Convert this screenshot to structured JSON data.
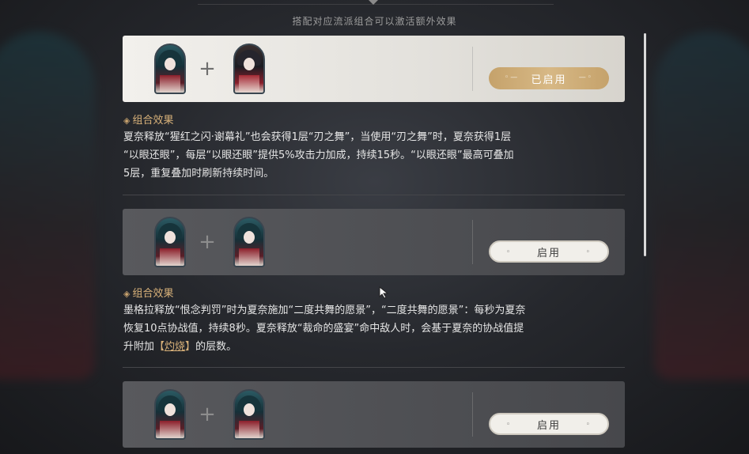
{
  "header": {
    "hint": "搭配对应流派组合可以激活额外效果"
  },
  "cards": [
    {
      "button_label": "已启用",
      "state": "enabled"
    },
    {
      "button_label": "启用",
      "state": "disabled"
    },
    {
      "button_label": "启用",
      "state": "disabled"
    }
  ],
  "effects": [
    {
      "title": "组合效果",
      "line1": "夏奈释放“猩红之闪·谢幕礼”也会获得1层“刃之舞”，当使用“刃之舞”时，夏奈获得1层",
      "line2": "“以眼还眼”，每层“以眼还眼”提供5%攻击力加成，持续15秒。“以眼还眼”最高可叠加",
      "line3": "5层，重复叠加时刷新持续时间。"
    },
    {
      "title": "组合效果",
      "line1": "墨格拉释放“恨念判罚”时为夏奈施加“二度共舞的愿景”，“二度共舞的愿景”：每秒为夏奈",
      "line2": "恢复10点协战值，持续8秒。夏奈释放“裁命的盛宴”命中敌人时，会基于夏奈的协战值提",
      "line3_pre": "升附加",
      "line3_bracket_open": "【",
      "line3_keyword": "灼烧",
      "line3_bracket_close": "】",
      "line3_post": "的层数。"
    }
  ],
  "icons": {
    "plus": "+",
    "title_marker": "◈"
  },
  "colors": {
    "accent_gold": "#d9b27a",
    "button_gold": "#c5a26b"
  }
}
